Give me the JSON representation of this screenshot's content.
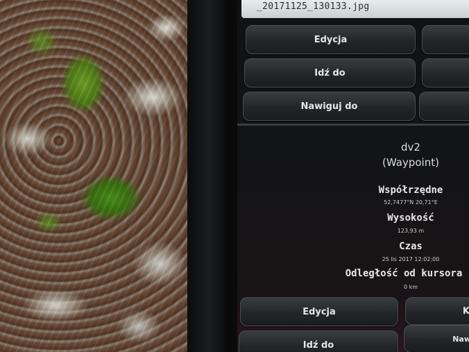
{
  "file": {
    "name": "_20171125_130133.jpg"
  },
  "buttons": {
    "edit": "Edycja",
    "goto": "Idź do",
    "navigate": "Nawiguj do",
    "edit2": "Edycja",
    "goto2": "Idź do",
    "right_partial": "K",
    "right_partial2": "Naw"
  },
  "waypoint": {
    "name": "dv2",
    "type": "(Waypoint)",
    "coords_label": "Współrzędne",
    "coords_value": "52,7477°N 20,71°E",
    "alt_label": "Wysokość",
    "alt_value": "123,93 m",
    "time_label": "Czas",
    "time_value": "25 lis 2017 12:02:00",
    "dist_label": "Odległość od kursora",
    "dist_value": "0 km"
  }
}
